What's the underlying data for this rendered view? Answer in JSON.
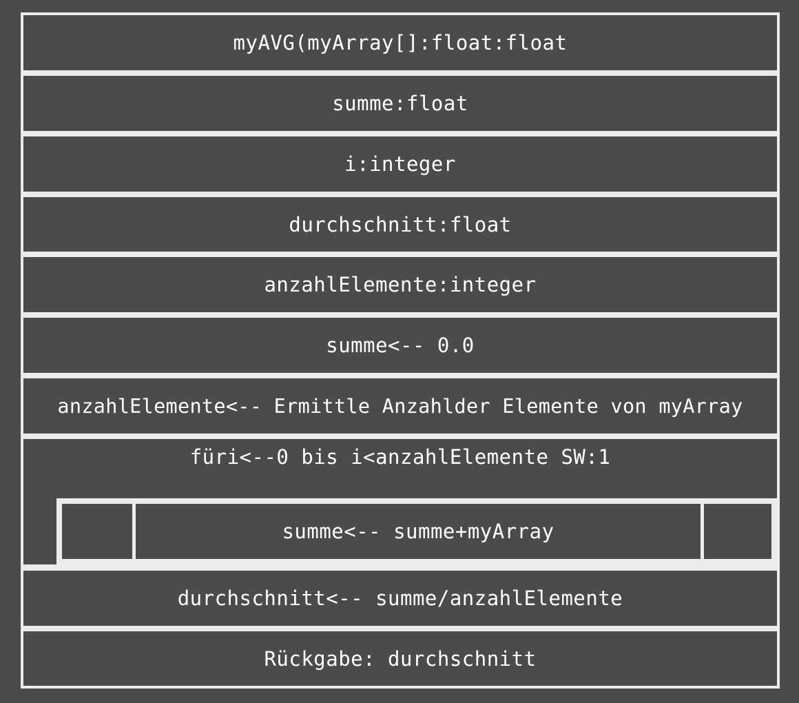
{
  "diagram": {
    "header": "myAVG(myArray[]:float:float",
    "declarations": [
      "summe:float",
      "i:integer",
      "durchschnitt:float",
      "anzahlElemente:integer"
    ],
    "statements_before_loop": [
      "summe<-- 0.0",
      "anzahlElemente<-- Ermittle Anzahlder Elemente von myArray"
    ],
    "loop": {
      "header": "füri<--0 bis i<anzahlElemente SW:1",
      "body": "summe<-- summe+myArray"
    },
    "statements_after_loop": [
      "durchschnitt<-- summe/anzahlElemente",
      "Rückgabe: durchschnitt"
    ]
  },
  "colors": {
    "background": "#4b4b4b",
    "border": "#ebebeb",
    "text": "#ffffff"
  }
}
